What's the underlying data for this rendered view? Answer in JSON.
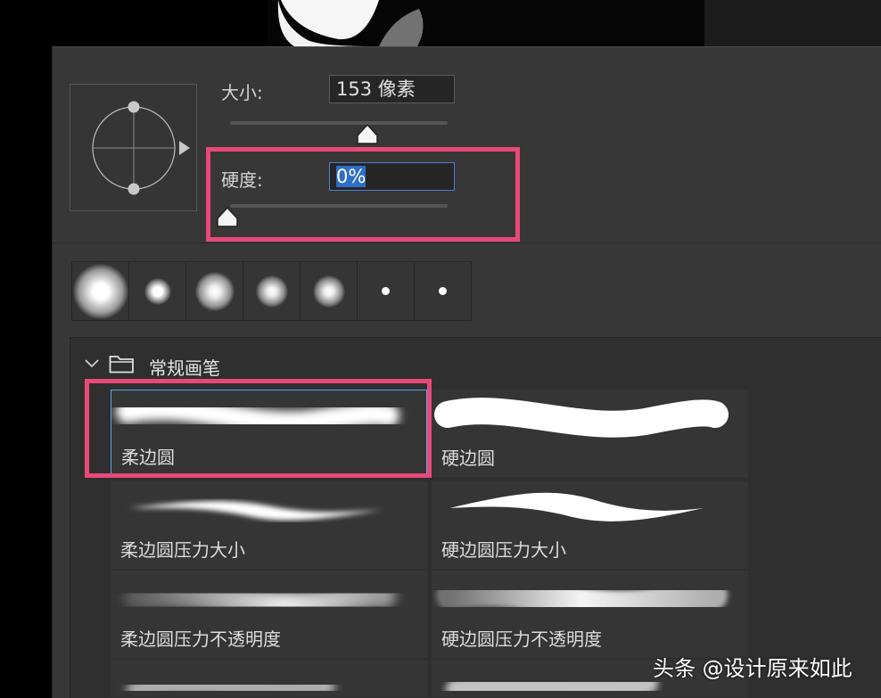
{
  "size": {
    "label": "大小:",
    "value": "153 像素",
    "slider_percent": 60
  },
  "hardness": {
    "label": "硬度:",
    "value": "0%",
    "slider_percent": 0
  },
  "brush_tips": [
    "soft-large",
    "soft-small",
    "soft-medium",
    "soft-small",
    "soft-small",
    "hard-tiny",
    "hard-tiny"
  ],
  "folder": {
    "name": "常规画笔",
    "icon": "folder-icon",
    "expand_icon": "chevron-down-icon"
  },
  "brushes": [
    {
      "label": "柔边圆",
      "selected": true
    },
    {
      "label": "硬边圆"
    },
    {
      "label": "柔边圆压力大小"
    },
    {
      "label": "硬边圆压力大小"
    },
    {
      "label": "柔边圆压力不透明度"
    },
    {
      "label": "硬边圆压力不透明度"
    }
  ],
  "watermark": "头条 @设计原来如此",
  "colors": {
    "highlight": "#e8497a",
    "accent": "#2e6ec9",
    "panel": "#373737"
  }
}
